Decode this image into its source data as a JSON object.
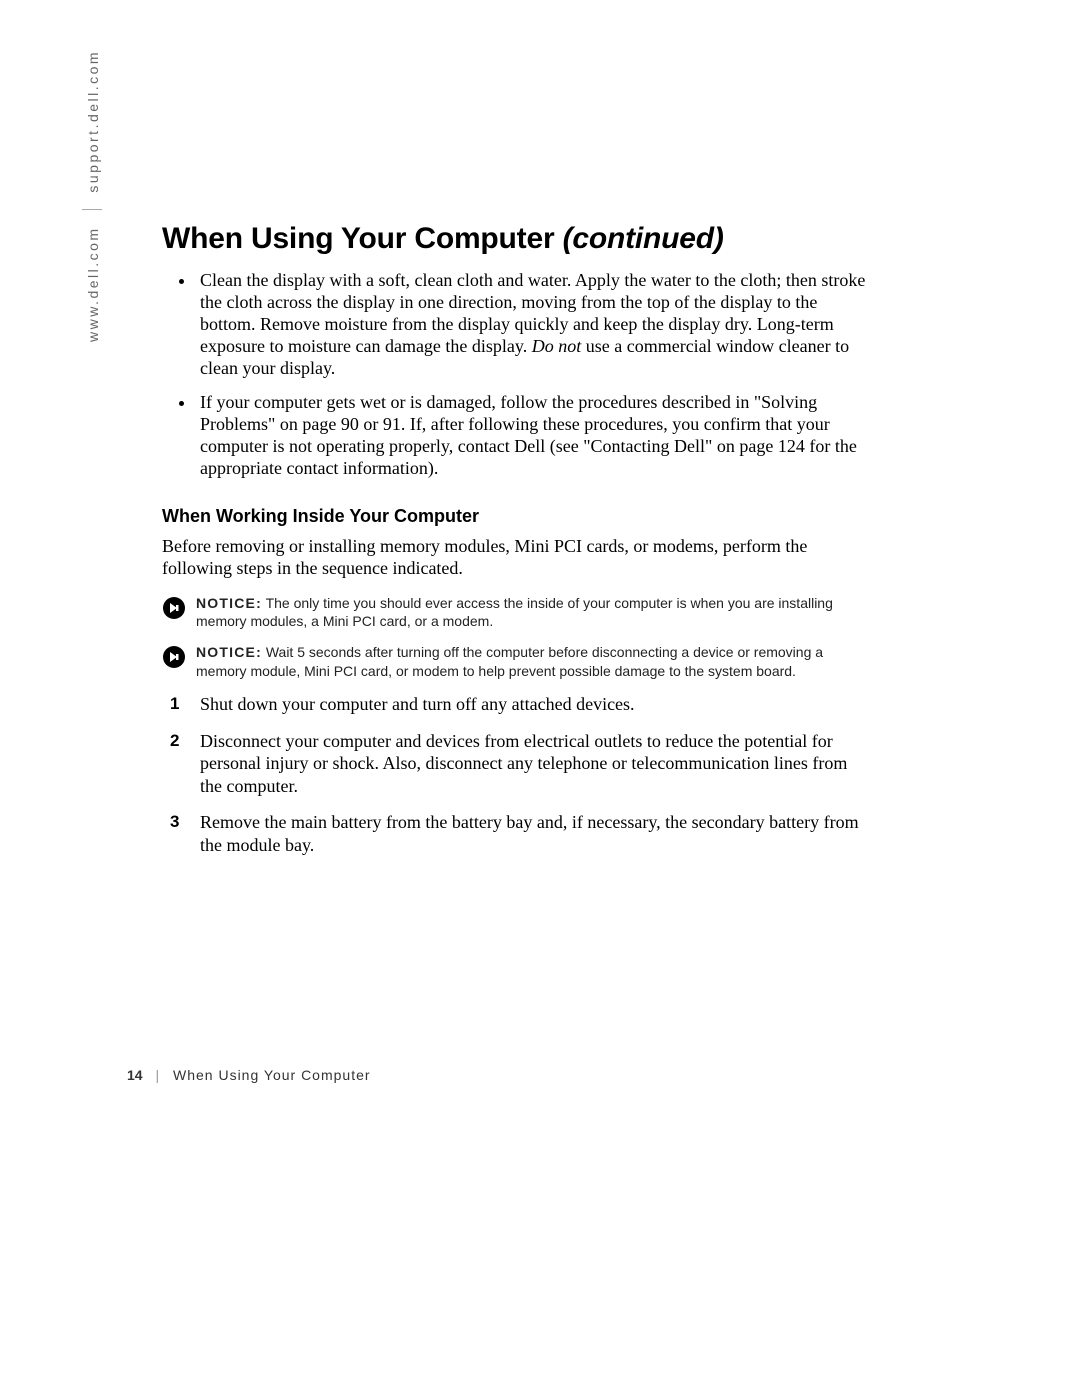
{
  "sidebar": {
    "part1": "www.dell.com",
    "part2": "support.dell.com"
  },
  "heading": {
    "main": "When Using Your Computer ",
    "continued": "(continued)"
  },
  "bullets": [
    {
      "before": "Clean the display with a soft, clean cloth and water. Apply the water to the cloth; then stroke the cloth across the display in one direction, moving from the top of the display to the bottom. Remove moisture from the display quickly and keep the display dry. Long-term exposure to moisture can damage the display. ",
      "donot": "Do not",
      "after": " use a commercial window cleaner to clean your display."
    },
    {
      "before": "If your computer gets wet or is damaged, follow the procedures described in \"Solving Problems\" on page 90 or 91. If, after following these procedures, you confirm that your computer is not operating properly, contact Dell (see \"Contacting Dell\" on page 124 for the appropriate contact information).",
      "donot": "",
      "after": ""
    }
  ],
  "subheading": "When Working Inside Your Computer",
  "intro": "Before removing or installing memory modules, Mini PCI cards, or modems, perform the following steps in the sequence indicated.",
  "notices": [
    {
      "label": "NOTICE:",
      "text": " The only time you should ever access the inside of your computer is when you are installing memory modules, a Mini PCI card, or a modem."
    },
    {
      "label": "NOTICE:",
      "text": " Wait 5 seconds after turning off the computer before disconnecting a device or removing a memory module, Mini PCI card, or modem to help prevent possible damage to the system board."
    }
  ],
  "steps": [
    "Shut down your computer and turn off any attached devices.",
    "Disconnect your computer and devices from electrical outlets to reduce the potential for personal injury or shock. Also, disconnect any telephone or telecommunication lines from the computer.",
    "Remove the main battery from the battery bay and, if necessary, the secondary battery from the module bay."
  ],
  "footer": {
    "page": "14",
    "title": "When Using Your Computer"
  }
}
